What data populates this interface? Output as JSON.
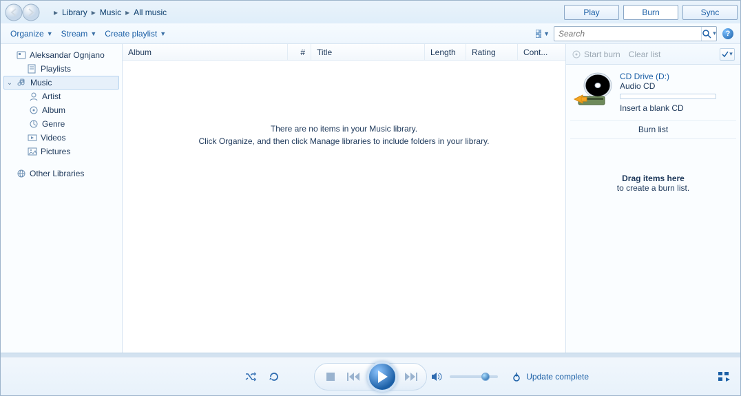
{
  "breadcrumb": [
    "Library",
    "Music",
    "All music"
  ],
  "tabs": {
    "play": "Play",
    "burn": "Burn",
    "sync": "Sync",
    "active": "burn"
  },
  "toolbar": {
    "organize": "Organize",
    "stream": "Stream",
    "create_playlist": "Create playlist"
  },
  "search": {
    "placeholder": "Search"
  },
  "tree": {
    "root": "Aleksandar Ognjano",
    "playlists": "Playlists",
    "music": "Music",
    "artist": "Artist",
    "album": "Album",
    "genre": "Genre",
    "videos": "Videos",
    "pictures": "Pictures",
    "other": "Other Libraries"
  },
  "columns": {
    "album": "Album",
    "num": "#",
    "title": "Title",
    "length": "Length",
    "rating": "Rating",
    "cont": "Cont..."
  },
  "empty": {
    "line1": "There are no items in your Music library.",
    "line2": "Click Organize, and then click Manage libraries to include folders in your library."
  },
  "right": {
    "startburn": "Start burn",
    "clearlist": "Clear list",
    "drive_name": "CD Drive (D:)",
    "drive_type": "Audio CD",
    "insert": "Insert a blank CD",
    "burnlist": "Burn list",
    "drag": "Drag items here",
    "create": "to create a burn list."
  },
  "player": {
    "status": "Update complete"
  }
}
